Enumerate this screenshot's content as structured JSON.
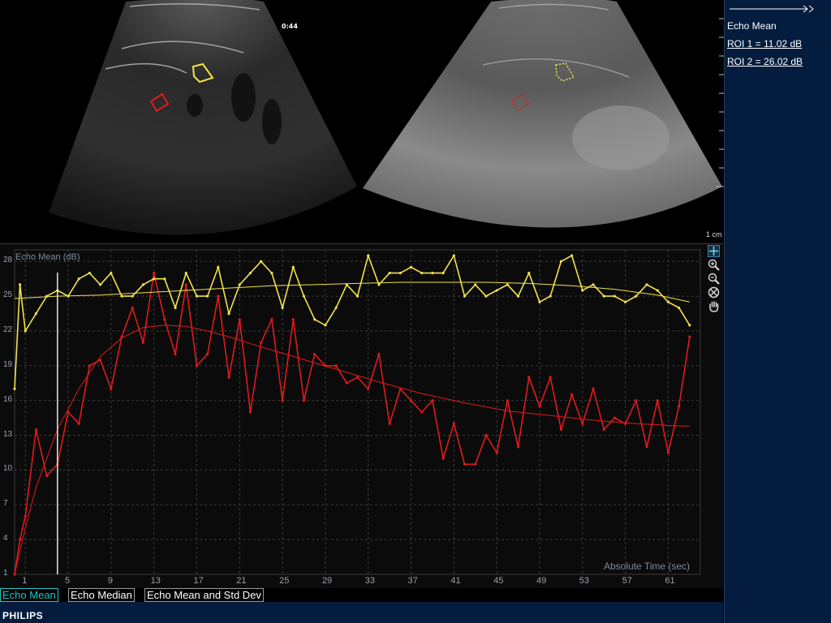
{
  "ultrasound": {
    "timer": "0:44",
    "scale_label": "1 cm"
  },
  "sidebar": {
    "title": "Echo Mean",
    "roi1": "ROI 1 = 11.02 dB",
    "roi2": "ROI 2 = 26.02 dB"
  },
  "graph": {
    "ylabel": "Echo Mean (dB)",
    "xlabel": "Absolute Time (sec)"
  },
  "tabs": [
    "Echo Mean",
    "Echo Median",
    "Echo Mean and Std Dev"
  ],
  "active_tab": "Echo Mean",
  "brand": "PHILIPS",
  "colors": {
    "roi1": "#e01a1a",
    "roi2": "#f1e34a",
    "sidebar": "#041c3d",
    "active_tab": "#1ec7c7"
  },
  "tools": [
    "add-icon",
    "zoom-in-icon",
    "zoom-out-icon",
    "reset-icon",
    "pan-hand-icon"
  ],
  "chart_data": {
    "type": "line",
    "ylabel": "Echo Mean (dB)",
    "xlabel": "Absolute Time (sec)",
    "xlim": [
      0,
      64
    ],
    "ylim": [
      1,
      29
    ],
    "x_ticks": [
      1,
      5,
      9,
      13,
      17,
      21,
      25,
      29,
      33,
      37,
      41,
      45,
      49,
      53,
      57,
      61
    ],
    "y_ticks": [
      1,
      4,
      7,
      10,
      13,
      16,
      19,
      22,
      25,
      28
    ],
    "cursor_x": 4,
    "series": [
      {
        "name": "ROI 1",
        "color": "#e01a1a",
        "x": [
          0,
          0.5,
          1,
          2,
          3,
          4,
          5,
          6,
          7,
          8,
          9,
          10,
          11,
          12,
          13,
          14,
          15,
          16,
          17,
          18,
          19,
          20,
          21,
          22,
          23,
          24,
          25,
          26,
          27,
          28,
          29,
          30,
          31,
          32,
          33,
          34,
          35,
          36,
          37,
          38,
          39,
          40,
          41,
          42,
          43,
          44,
          45,
          46,
          47,
          48,
          49,
          50,
          51,
          52,
          53,
          54,
          55,
          56,
          57,
          58,
          59,
          60,
          61,
          62,
          63
        ],
        "values": [
          1,
          4,
          6,
          13.5,
          9.5,
          10.5,
          15,
          14,
          19,
          19.5,
          17,
          21.5,
          24,
          21,
          27,
          23,
          20,
          26,
          19,
          20,
          25,
          18,
          23,
          15,
          21,
          23,
          16,
          23,
          16,
          20,
          19,
          19,
          17.5,
          18,
          17,
          20,
          14,
          17,
          16,
          15,
          16,
          11,
          14,
          10.5,
          10.5,
          13,
          11.5,
          16,
          12,
          18,
          15.5,
          18,
          13.5,
          16.5,
          14,
          17,
          13.5,
          14.5,
          14,
          16,
          12,
          16,
          11.5,
          15.5,
          21.5
        ]
      },
      {
        "name": "ROI 1 fit",
        "color": "#e01a1a",
        "x": [
          0,
          1,
          2,
          3,
          4,
          6,
          8,
          10,
          12,
          14,
          16,
          18,
          20,
          22,
          26,
          30,
          34,
          38,
          42,
          46,
          50,
          54,
          58,
          62,
          63
        ],
        "values": [
          1,
          5,
          8.5,
          11,
          13.5,
          17,
          19.8,
          21.4,
          22.3,
          22.5,
          22.4,
          22.0,
          21.5,
          20.9,
          19.8,
          18.7,
          17.6,
          16.6,
          15.8,
          15.1,
          14.7,
          14.3,
          14.0,
          13.8,
          13.8
        ]
      },
      {
        "name": "ROI 2",
        "color": "#f1e34a",
        "x": [
          0,
          0.5,
          1,
          2,
          3,
          4,
          5,
          6,
          7,
          8,
          9,
          10,
          11,
          12,
          13,
          14,
          15,
          16,
          17,
          18,
          19,
          20,
          21,
          22,
          23,
          24,
          25,
          26,
          27,
          28,
          29,
          30,
          31,
          32,
          33,
          34,
          35,
          36,
          37,
          38,
          39,
          40,
          41,
          42,
          43,
          44,
          45,
          46,
          47,
          48,
          49,
          50,
          51,
          52,
          53,
          54,
          55,
          56,
          57,
          58,
          59,
          60,
          61,
          62,
          63
        ],
        "values": [
          17,
          26,
          22,
          23.5,
          25,
          25.5,
          25,
          26.5,
          27,
          26,
          27,
          25,
          25,
          26,
          26.5,
          26.5,
          24,
          27,
          25,
          25,
          27.5,
          23.5,
          26,
          27,
          28,
          27,
          24,
          27.5,
          25,
          23,
          22.5,
          24,
          26,
          25,
          28.5,
          26,
          27,
          27,
          27.5,
          27,
          27,
          27,
          28.5,
          25,
          26,
          25,
          25.5,
          26,
          25,
          27,
          24.5,
          25,
          28,
          28.5,
          25.5,
          26,
          25,
          25,
          24.5,
          25,
          26,
          25.5,
          24.5,
          24,
          22.5
        ]
      },
      {
        "name": "ROI 2 fit",
        "color": "#f1e34a",
        "x": [
          0,
          4,
          8,
          12,
          16,
          20,
          24,
          28,
          32,
          36,
          40,
          44,
          48,
          52,
          56,
          60,
          63
        ],
        "values": [
          24.8,
          25.0,
          25.1,
          25.3,
          25.5,
          25.7,
          25.9,
          26.0,
          26.1,
          26.2,
          26.2,
          26.2,
          26.1,
          25.9,
          25.6,
          25.1,
          24.5
        ]
      }
    ]
  }
}
